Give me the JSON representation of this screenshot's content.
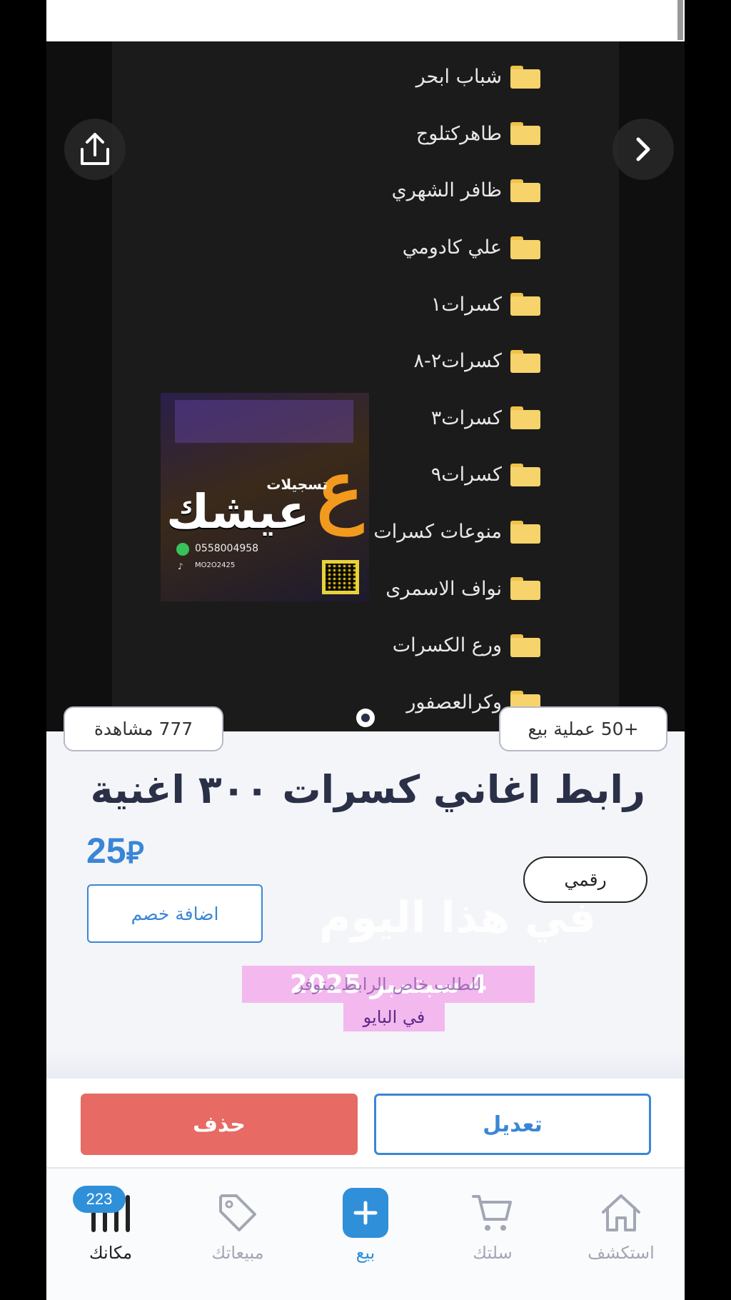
{
  "media": {
    "folders": [
      "شباب ابحر",
      "طاهركتلوج",
      "ظافر الشهري",
      "علي كادومي",
      "كسرات١",
      "كسرات٢-٨",
      "كسرات٣",
      "كسرات٩",
      "منوعات كسرات",
      "نواف الاسمرى",
      "ورع الكسرات",
      "وكرالعصفور"
    ],
    "logo": {
      "subtitle": "تسجيلات",
      "name": "عيشك",
      "phone": "0558004958",
      "handle": "MO2O2425"
    },
    "icons": {
      "share": "share-icon",
      "next": "chevron-right-icon"
    }
  },
  "stats": {
    "views": "777 مشاهدة",
    "sales": "+50 عملية بيع"
  },
  "product": {
    "title": "رابط اغاني كسرات ٣٠٠ اغنية",
    "price": "25",
    "currency": "⃁",
    "type": "رقمي",
    "discount_label": "اضافة خصم"
  },
  "overlay": {
    "watermark": "في هذا اليوم",
    "date": "4 سبتمبر 2025",
    "line1": "للطلب خاص الرابط متوفر",
    "line2": "في البايو"
  },
  "actions": {
    "delete_label": "حذف",
    "edit_label": "تعديل"
  },
  "nav": {
    "explore": "استكشف",
    "cart": "سلتك",
    "sell": "بيع",
    "sales": "مبيعاتك",
    "shop": "مكانك",
    "shop_badge": "223"
  },
  "colors": {
    "accent": "#2f8fd8",
    "delete": "#e76a64",
    "folder": "#f6d36b",
    "caption_bg": "#f3b8ee"
  }
}
